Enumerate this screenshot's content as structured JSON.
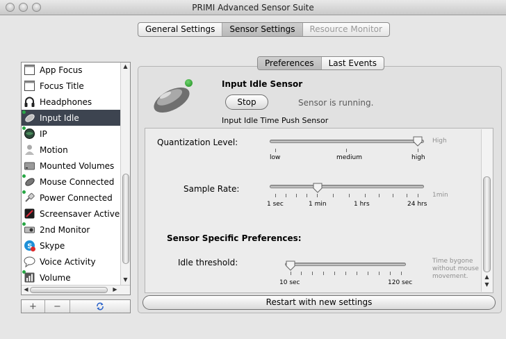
{
  "window": {
    "title": "PRIMI Advanced Sensor Suite"
  },
  "top_tabs": [
    {
      "label": "General Settings",
      "state": "normal"
    },
    {
      "label": "Sensor Settings",
      "state": "selected"
    },
    {
      "label": "Resource Monitor",
      "state": "disabled"
    }
  ],
  "sensor_list": {
    "items": [
      {
        "label": "App Focus",
        "icon": "window-icon",
        "selected": false,
        "active": false
      },
      {
        "label": "Focus Title",
        "icon": "window-icon",
        "selected": false,
        "active": false
      },
      {
        "label": "Headphones",
        "icon": "headphones-icon",
        "selected": false,
        "active": false
      },
      {
        "label": "Input Idle",
        "icon": "mouse-icon",
        "selected": true,
        "active": true
      },
      {
        "label": "IP",
        "icon": "globe-icon",
        "selected": false,
        "active": true
      },
      {
        "label": "Motion",
        "icon": "person-icon",
        "selected": false,
        "active": false
      },
      {
        "label": "Mounted Volumes",
        "icon": "drive-icon",
        "selected": false,
        "active": false
      },
      {
        "label": "Mouse Connected",
        "icon": "mouse-icon",
        "selected": false,
        "active": true
      },
      {
        "label": "Power Connected",
        "icon": "plug-icon",
        "selected": false,
        "active": true
      },
      {
        "label": "Screensaver Active",
        "icon": "screensaver-icon",
        "selected": false,
        "active": false
      },
      {
        "label": "2nd Monitor",
        "icon": "projector-icon",
        "selected": false,
        "active": true
      },
      {
        "label": "Skype",
        "icon": "skype-icon",
        "selected": false,
        "active": false
      },
      {
        "label": "Voice Activity",
        "icon": "speech-bubble-icon",
        "selected": false,
        "active": false
      },
      {
        "label": "Volume",
        "icon": "volume-icon",
        "selected": false,
        "active": true
      }
    ],
    "add_label": "+",
    "remove_label": "−",
    "refresh_icon": "refresh-icon"
  },
  "sub_tabs": [
    {
      "label": "Preferences",
      "state": "selected"
    },
    {
      "label": "Last Events",
      "state": "normal"
    }
  ],
  "sensor": {
    "name": "Input Idle Sensor",
    "stop_label": "Stop",
    "status": "Sensor is running.",
    "description": "Input Idle Time Push Sensor",
    "icon": "mouse-icon",
    "status_color": "#2e9e2e"
  },
  "quantization": {
    "label": "Quantization Level:",
    "ticks": [
      "low",
      "medium",
      "high"
    ],
    "value": "high",
    "value_label": "High"
  },
  "sample_rate": {
    "label": "Sample Rate:",
    "ticks": [
      "1 sec",
      "1 min",
      "1 hrs",
      "24 hrs"
    ],
    "value": "1 min",
    "value_label": "1min"
  },
  "specific": {
    "heading": "Sensor Specific Preferences:",
    "idle_threshold": {
      "label": "Idle threshold:",
      "min_label": "10 sec",
      "max_label": "120 sec",
      "value": "10 sec",
      "help": [
        "Time bygone",
        "without mouse",
        "movement."
      ]
    }
  },
  "restart_label": "Restart with new settings"
}
